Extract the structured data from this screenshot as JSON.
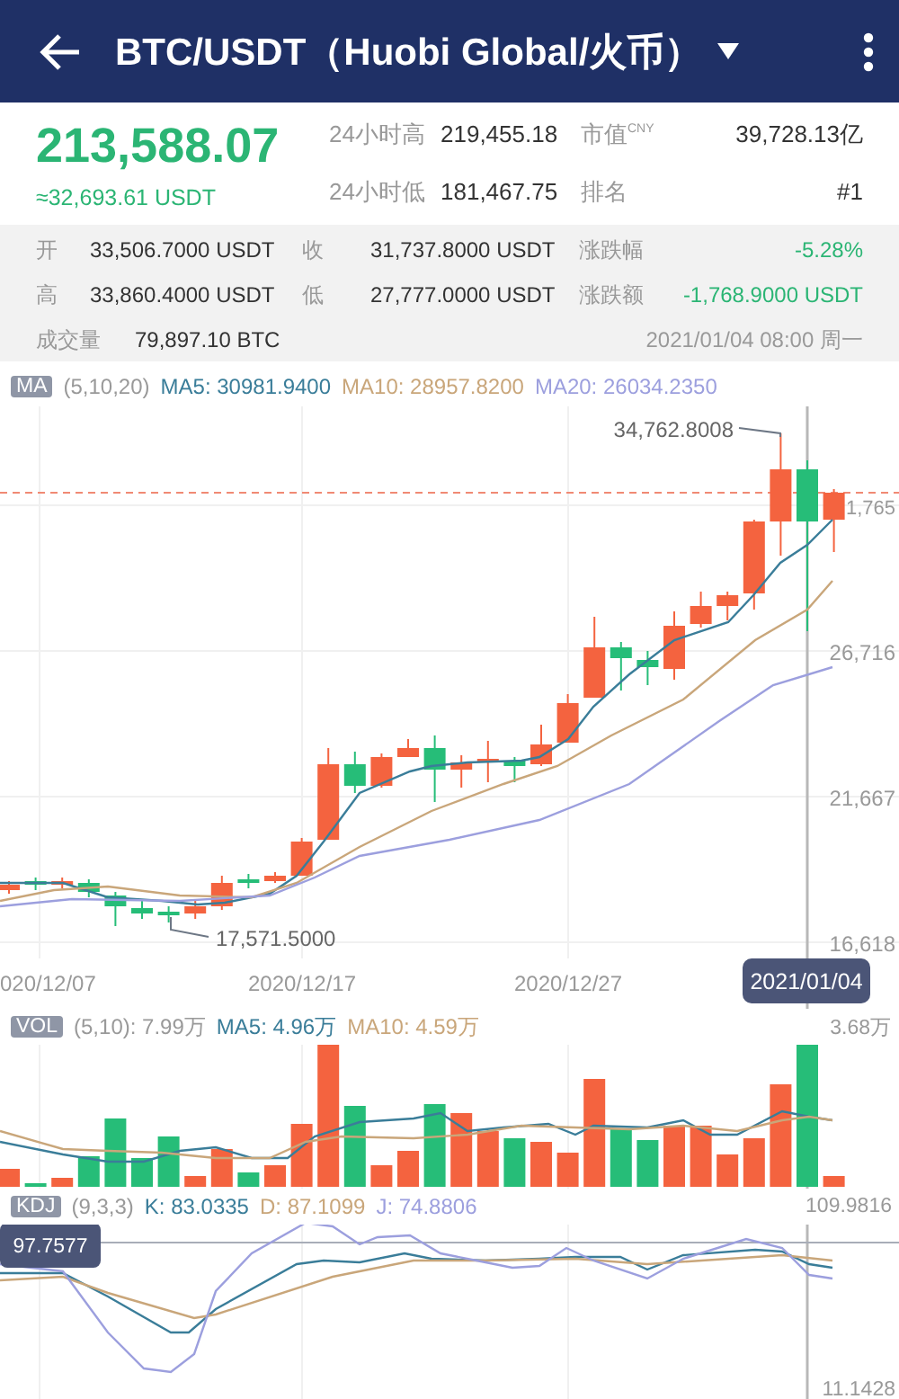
{
  "header": {
    "title": "BTC/USDT（Huobi Global/火币）"
  },
  "quote": {
    "price": "213,588.07",
    "converted": "≈32,693.61 USDT",
    "stats": [
      {
        "label": "24小时高",
        "value": "219,455.18"
      },
      {
        "label": "市值$^{CNY}$",
        "value": "39,728.13亿"
      },
      {
        "label": "24小时低",
        "value": "181,467.75"
      },
      {
        "label": "排名",
        "value": "#1"
      }
    ]
  },
  "details": {
    "items": [
      {
        "label": "开",
        "value": "33,506.7000 USDT",
        "kind": "plain"
      },
      {
        "label": "收",
        "value": "31,737.8000 USDT",
        "kind": "plain"
      },
      {
        "label": "涨跌幅",
        "value": "-5.28%",
        "kind": "change"
      },
      {
        "label": "高",
        "value": "33,860.4000 USDT",
        "kind": "plain"
      },
      {
        "label": "低",
        "value": "27,777.0000 USDT",
        "kind": "plain"
      },
      {
        "label": "涨跌额",
        "value": "-1,768.9000 USDT",
        "kind": "change"
      }
    ],
    "volume_label": "成交量",
    "volume": "79,897.10 BTC",
    "timestamp": "2021/01/04 08:00 周一"
  },
  "price_chart": {
    "badge": "MA",
    "params": "(5,10,20)",
    "items": [
      {
        "label": "MA5: 30981.9400",
        "color": "#3a7d99"
      },
      {
        "label": "MA10: 28957.8200",
        "color": "#c9a67a"
      },
      {
        "label": "MA20: 26034.2350",
        "color": "#9c9fde"
      }
    ],
    "axis": [
      "1,765",
      "26,716",
      "21,667",
      "16,618"
    ],
    "high_label": "34,762.8008",
    "low_label": "17,571.5000",
    "dates": [
      "020/12/07",
      "2020/12/17",
      "2020/12/27"
    ],
    "crosshair_date": "2021/01/04"
  },
  "volume_chart": {
    "badge": "VOL",
    "params": "(5,10): 7.99万",
    "items": [
      {
        "label": "MA5: 4.96万",
        "color": "#3a7d99"
      },
      {
        "label": "MA10: 4.59万",
        "color": "#c9a67a"
      }
    ],
    "axis_max": "3.68万"
  },
  "kdj_chart": {
    "badge": "KDJ",
    "params": "(9,3,3)",
    "items": [
      {
        "label": "K: 83.0335",
        "color": "#3a7d99"
      },
      {
        "label": "D: 87.1099",
        "color": "#c9a67a"
      },
      {
        "label": "J: 74.8806",
        "color": "#9c9fde"
      }
    ],
    "axis_max": "109.9816",
    "axis_min": "11.1428",
    "crosshair_value": "97.7577"
  }
}
